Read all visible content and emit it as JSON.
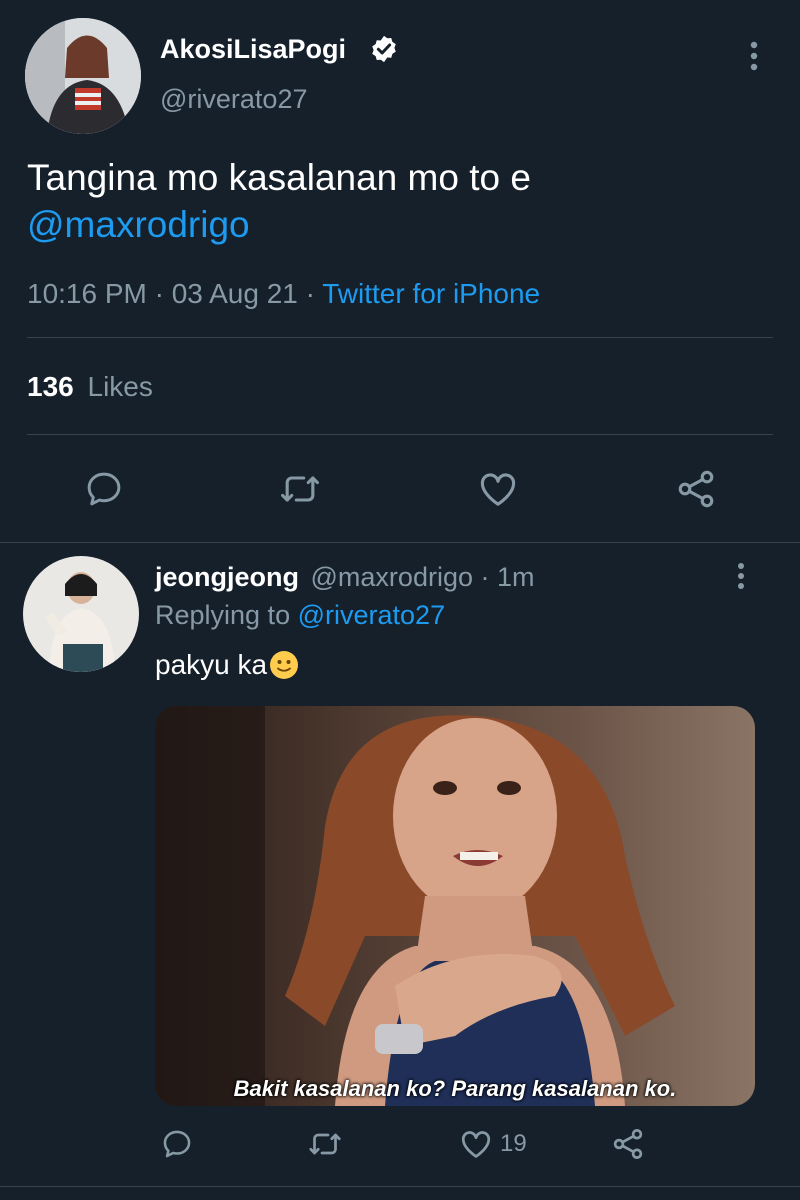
{
  "tweet": {
    "display_name": "AkosiLisaPogi",
    "handle": "@riverato27",
    "text": "Tangina mo kasalanan mo to e",
    "mention": "@maxrodrigo",
    "time": "10:16 PM · 03 Aug 21",
    "sep": "·",
    "source": "Twitter for iPhone",
    "likes_count": "136",
    "likes_label": "Likes",
    "verified": true
  },
  "reply": {
    "display_name": "jeongjeong",
    "handle_time": "@maxrodrigo · 1m",
    "replying_label": "Replying to",
    "replying_handle": "@riverato27",
    "text": "pakyu ka",
    "emoji": "🙂",
    "media_caption": "Bakit kasalanan ko? Parang kasalanan ko.",
    "like_count": "19"
  },
  "icons": {
    "more": "more-vertical-icon",
    "reply": "reply-icon",
    "retweet": "retweet-icon",
    "like": "heart-icon",
    "share": "share-icon",
    "verified": "verified-badge-icon"
  },
  "colors": {
    "background": "#15202b",
    "accent": "#1d9bf0",
    "muted": "#8899a6",
    "divider": "#38444d"
  }
}
